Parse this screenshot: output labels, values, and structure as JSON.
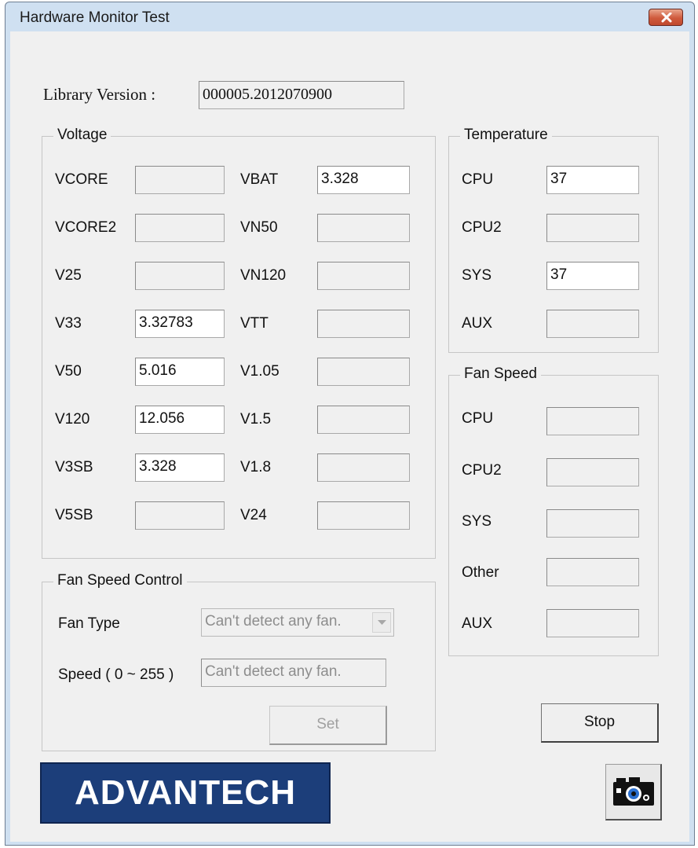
{
  "window": {
    "title": "Hardware Monitor Test"
  },
  "library": {
    "label": "Library Version :",
    "value": "000005.2012070900"
  },
  "voltage": {
    "title": "Voltage",
    "left": [
      {
        "label": "VCORE",
        "value": ""
      },
      {
        "label": "VCORE2",
        "value": ""
      },
      {
        "label": "V25",
        "value": ""
      },
      {
        "label": "V33",
        "value": "3.32783"
      },
      {
        "label": "V50",
        "value": "5.016"
      },
      {
        "label": "V120",
        "value": "12.056"
      },
      {
        "label": "V3SB",
        "value": "3.328"
      },
      {
        "label": "V5SB",
        "value": ""
      }
    ],
    "right": [
      {
        "label": "VBAT",
        "value": "3.328"
      },
      {
        "label": "VN50",
        "value": ""
      },
      {
        "label": "VN120",
        "value": ""
      },
      {
        "label": "VTT",
        "value": ""
      },
      {
        "label": "V1.05",
        "value": ""
      },
      {
        "label": "V1.5",
        "value": ""
      },
      {
        "label": "V1.8",
        "value": ""
      },
      {
        "label": "V24",
        "value": ""
      }
    ]
  },
  "temperature": {
    "title": "Temperature",
    "rows": [
      {
        "label": "CPU",
        "value": "37"
      },
      {
        "label": "CPU2",
        "value": ""
      },
      {
        "label": "SYS",
        "value": "37"
      },
      {
        "label": "AUX",
        "value": ""
      }
    ]
  },
  "fan_speed": {
    "title": "Fan Speed",
    "rows": [
      {
        "label": "CPU",
        "value": ""
      },
      {
        "label": "CPU2",
        "value": ""
      },
      {
        "label": "SYS",
        "value": ""
      },
      {
        "label": "Other",
        "value": ""
      },
      {
        "label": "AUX",
        "value": ""
      }
    ]
  },
  "fan_control": {
    "title": "Fan Speed Control",
    "fan_type_label": "Fan Type",
    "fan_type_value": "Can't detect any fan.",
    "speed_label": "Speed ( 0 ~ 255 )",
    "speed_value": "Can't detect any fan.",
    "set_label": "Set"
  },
  "buttons": {
    "stop_label": "Stop"
  },
  "logo": {
    "text": "ADVANTECH"
  },
  "icons": {
    "close": "close-icon",
    "dropdown": "chevron-down-icon",
    "camera": "camera-icon"
  },
  "colors": {
    "logo_bg": "#1c3e7a",
    "close_button": "#cf5a3c",
    "window_frame": "#cfe0f1"
  }
}
